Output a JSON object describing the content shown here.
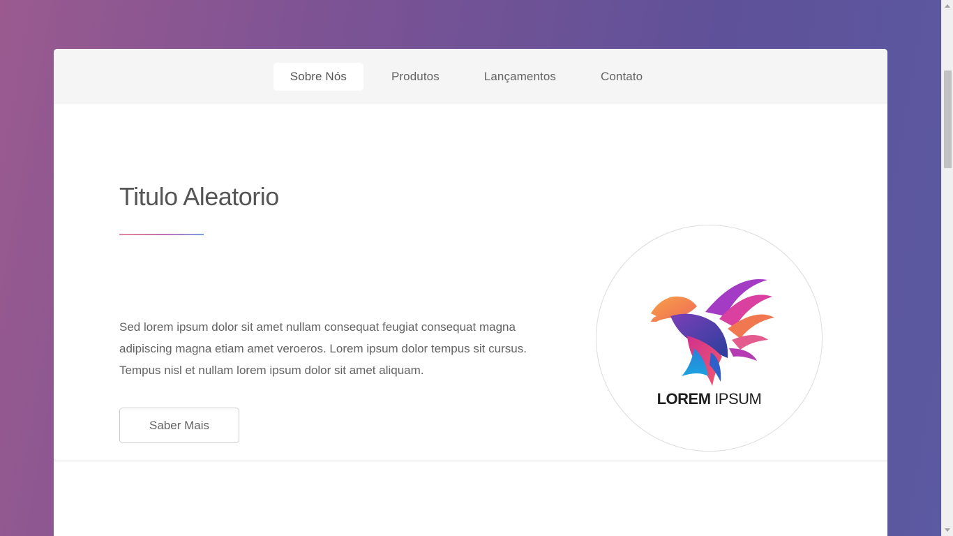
{
  "nav": {
    "items": [
      {
        "label": "Sobre Nós"
      },
      {
        "label": "Produtos"
      },
      {
        "label": "Lançamentos"
      },
      {
        "label": "Contato"
      }
    ]
  },
  "hero": {
    "title": "Titulo Aleatorio",
    "paragraph": [
      "Sed lorem ipsum dolor sit amet nullam consequat feugiat consequat magna",
      "adipiscing magna etiam amet veroeros. Lorem ipsum dolor tempus sit cursus.",
      "Tempus nisl et nullam lorem ipsum dolor sit amet aliquam."
    ],
    "button_label": "Saber Mais"
  },
  "logo": {
    "word_bold": "LOREM",
    "word_light": "IPSUM",
    "icon": "bird-icon"
  },
  "colors": {
    "background_start": "#9a5a8f",
    "background_end": "#5b5aa2",
    "divider_start": "#e8879c",
    "divider_end": "#7b9ee6"
  }
}
